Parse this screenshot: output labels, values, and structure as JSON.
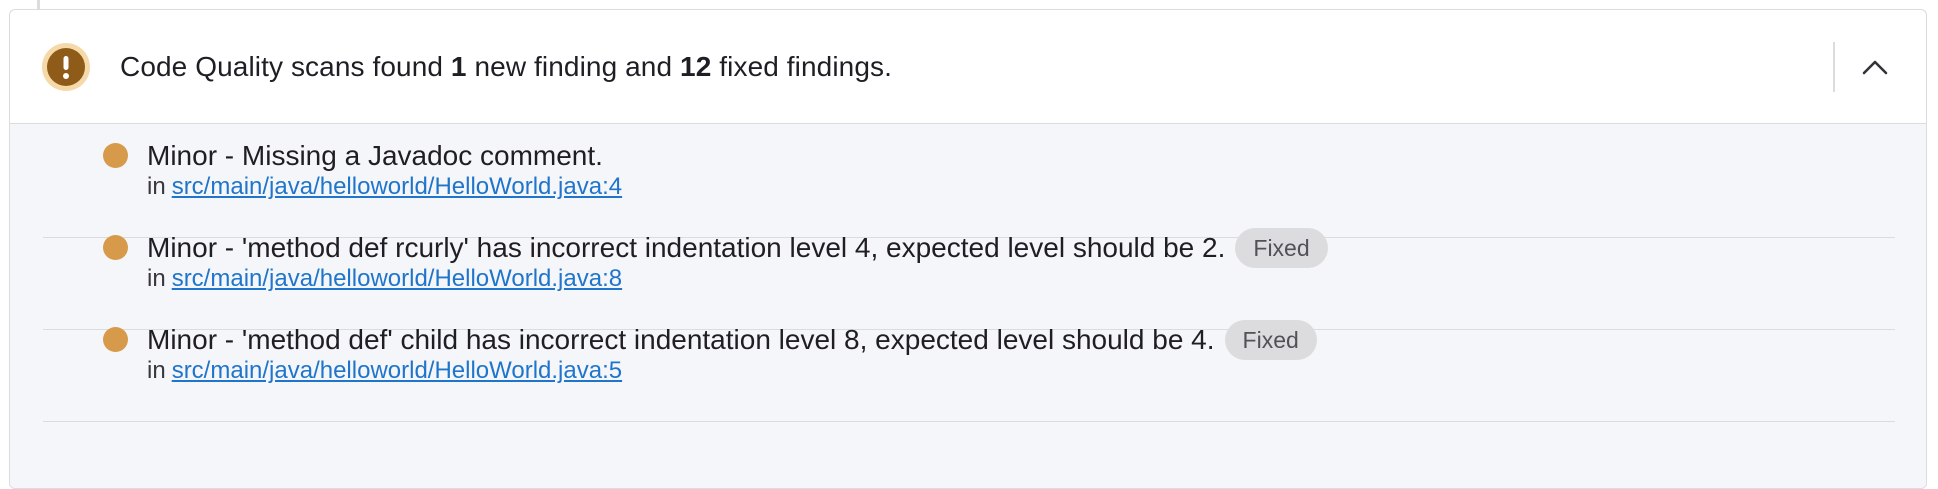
{
  "summary": {
    "prefix": "Code Quality scans found ",
    "new_count": "1",
    "middle": " new finding and ",
    "fixed_count": "12",
    "suffix": " fixed findings."
  },
  "status_icon": "warning-icon",
  "collapse_icon": "chevron-up-icon",
  "colors": {
    "status_bg": "#f5d9a8",
    "status_fg": "#8f5b18",
    "severity_minor": "#d79a4a",
    "link": "#1f75cb",
    "badge_bg": "#dcdcde"
  },
  "findings": [
    {
      "severity_icon": "severity-minor-icon",
      "title": "Minor - Missing a Javadoc comment.",
      "badge": "",
      "location_prefix": "in",
      "location": "src/main/java/helloworld/HelloWorld.java:4"
    },
    {
      "severity_icon": "severity-minor-icon",
      "title": "Minor - 'method def rcurly' has incorrect indentation level 4, expected level should be 2.",
      "badge": "Fixed",
      "location_prefix": "in",
      "location": "src/main/java/helloworld/HelloWorld.java:8"
    },
    {
      "severity_icon": "severity-minor-icon",
      "title": "Minor - 'method def' child has incorrect indentation level 8, expected level should be 4.",
      "badge": "Fixed",
      "location_prefix": "in",
      "location": "src/main/java/helloworld/HelloWorld.java:5"
    }
  ]
}
